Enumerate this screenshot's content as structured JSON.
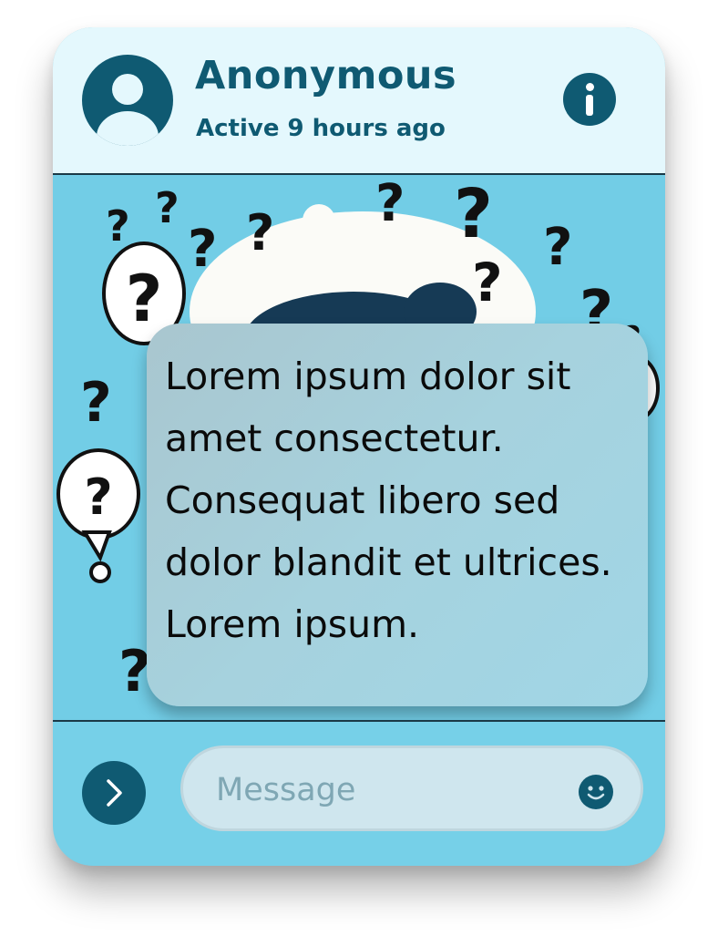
{
  "header": {
    "name": "Anonymous",
    "status": "Active 9 hours ago",
    "avatar_icon": "user-avatar-icon",
    "info_icon": "info-icon"
  },
  "scene": {
    "description_icon": "question-marks-illustration",
    "bubble_text": "Lorem ipsum dolor sit amet consectetur. Consequat libero sed dolor blandit et ultrices. Lorem ipsum."
  },
  "composer": {
    "send_icon": "chevron-right-icon",
    "placeholder": "Message",
    "emoji_icon": "smiley-icon"
  },
  "colors": {
    "primary": "#0f5a72",
    "header_bg": "#e4f8fd",
    "chat_bg": "#76d0e8",
    "bubble_bg": "#a6d2de"
  }
}
